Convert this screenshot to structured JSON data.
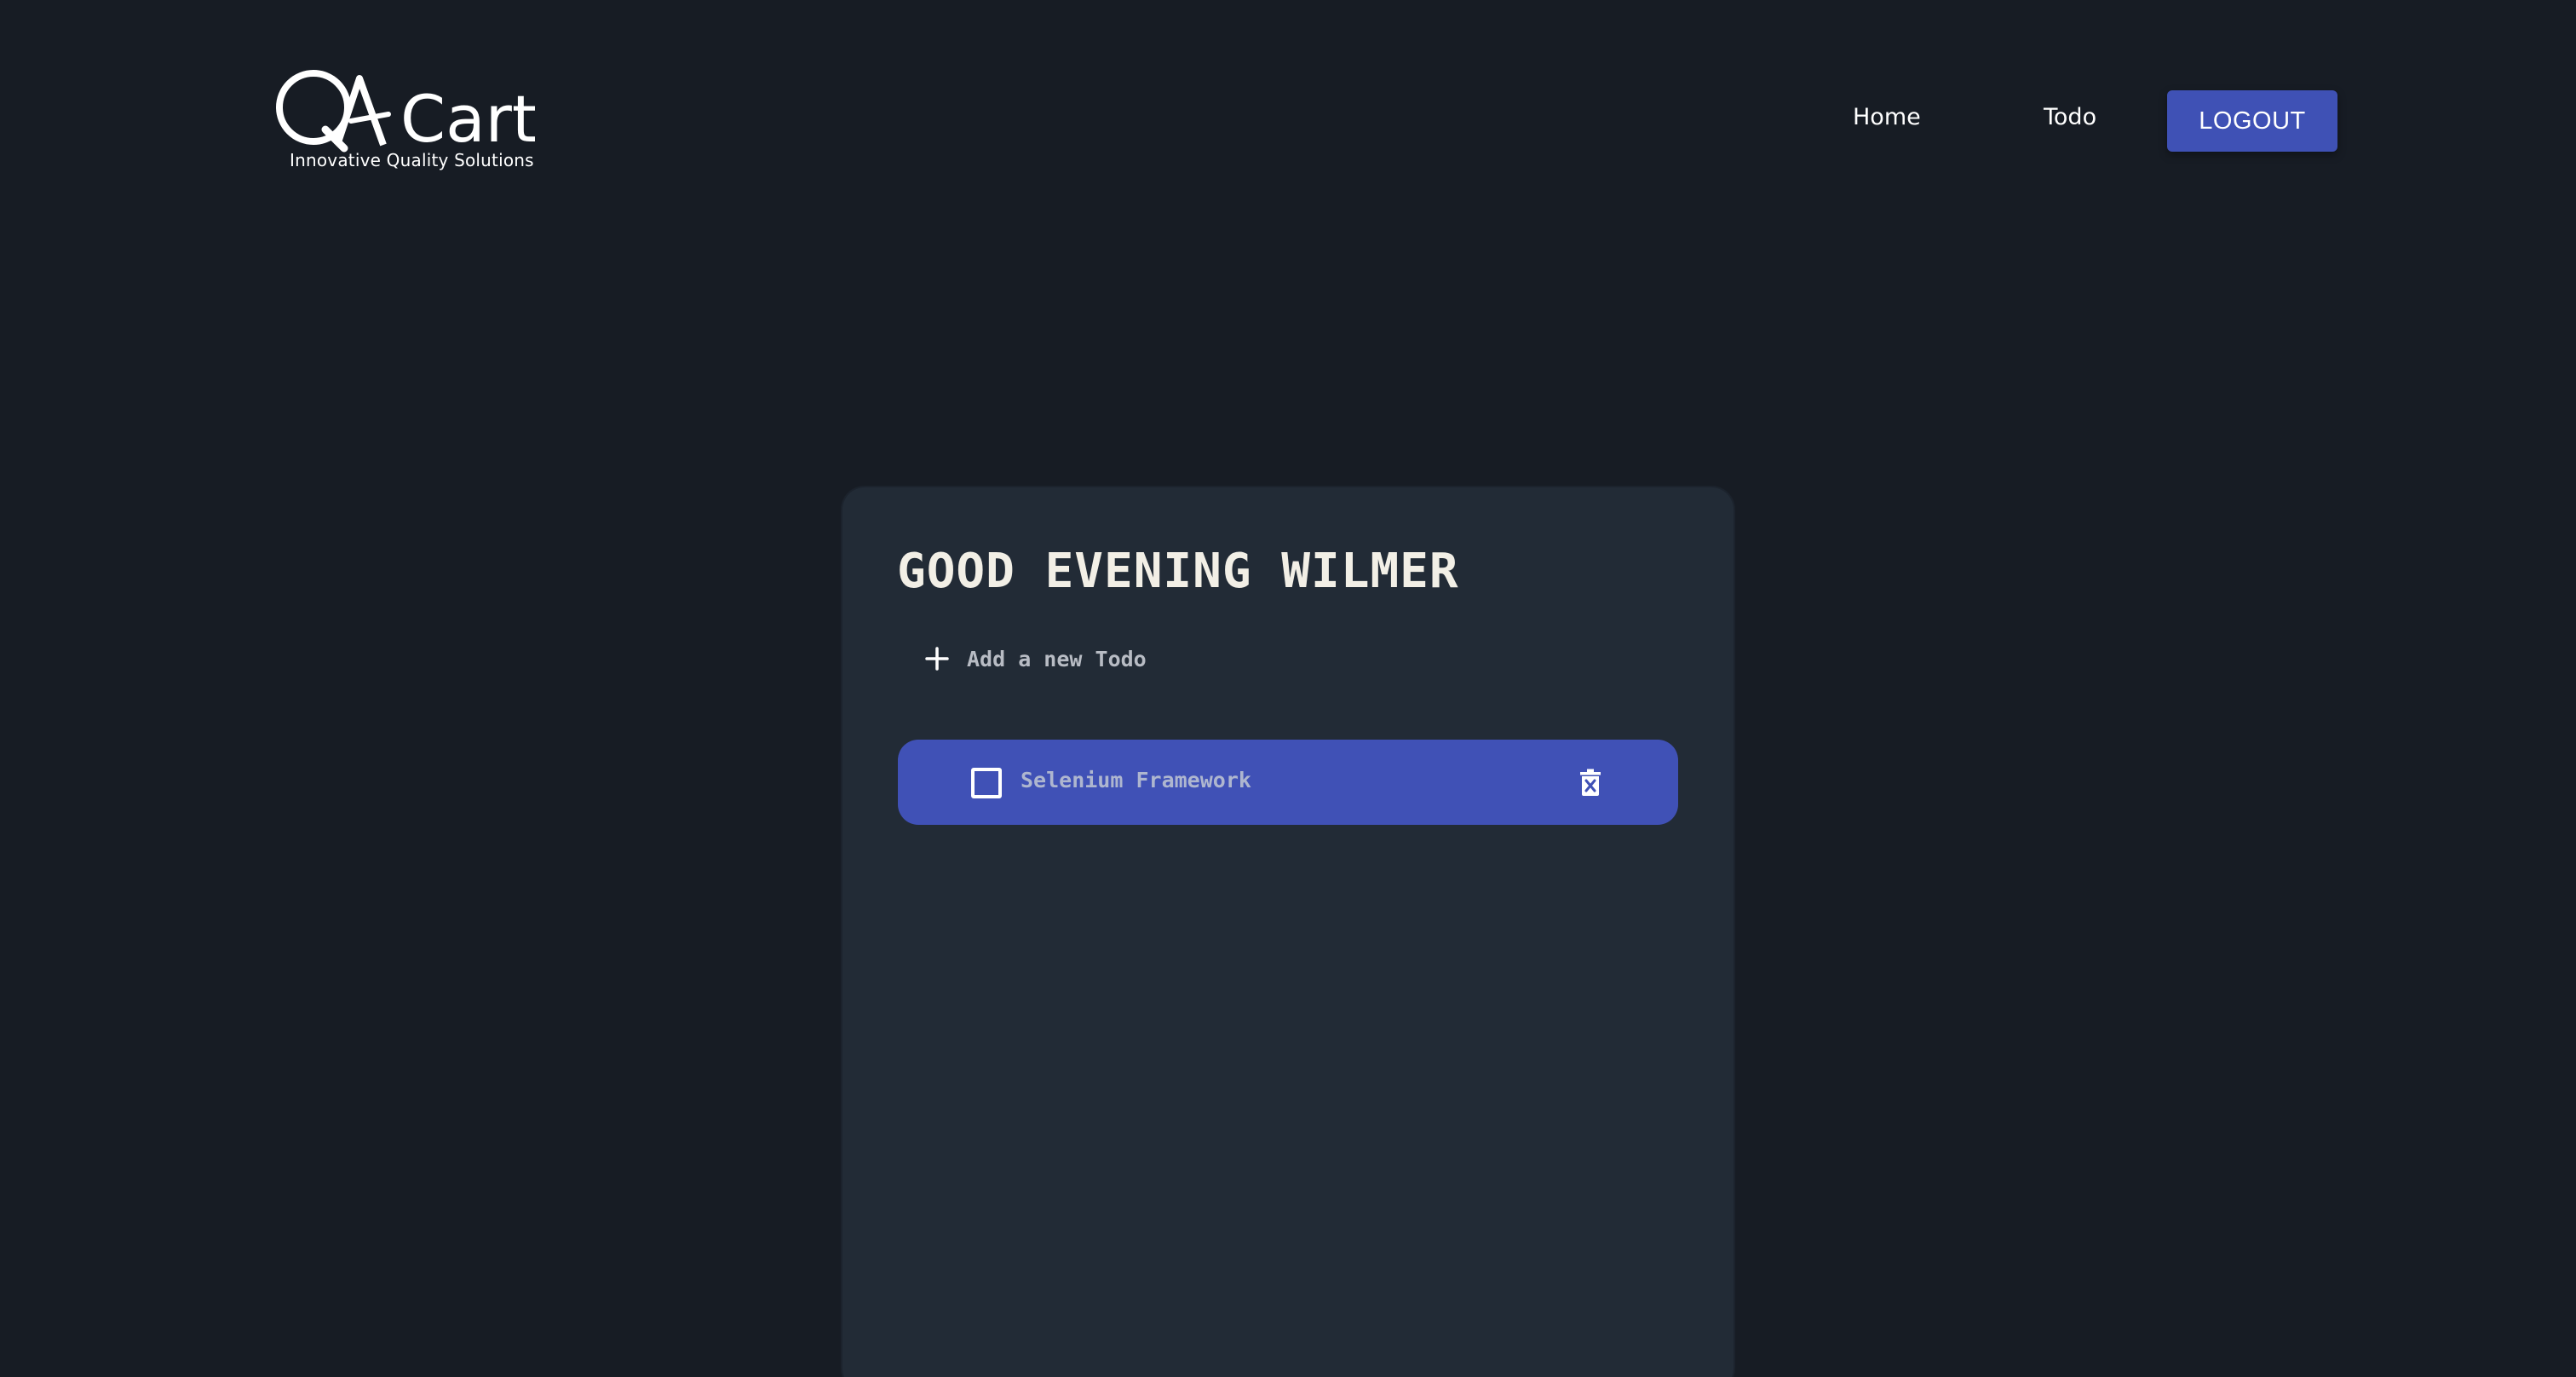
{
  "header": {
    "logo": {
      "brand": "QA Cart",
      "wordmark_part": "Cart",
      "tagline": "Innovative Quality Solutions"
    },
    "nav": {
      "home_label": "Home",
      "todo_label": "Todo"
    },
    "logout_label": "LOGOUT"
  },
  "card": {
    "greeting": "GOOD EVENING WILMER",
    "add_todo": {
      "placeholder": "Add a new Todo",
      "icon": "plus-icon"
    },
    "todos": [
      {
        "text": "Selenium Framework",
        "completed": false,
        "checkbox_icon": "checkbox-empty-icon",
        "delete_icon": "trash-icon"
      }
    ]
  },
  "colors": {
    "background": "#171c24",
    "card": "#222b36",
    "accent": "#3f51b5",
    "greeting_text": "#f2efe6"
  }
}
